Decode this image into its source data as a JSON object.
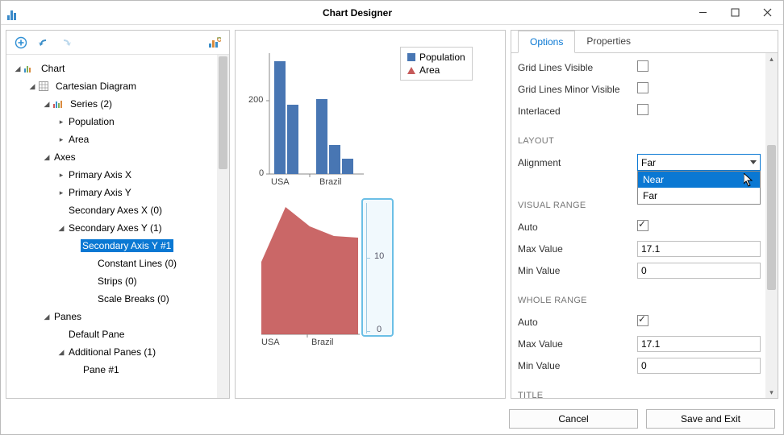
{
  "window": {
    "title": "Chart Designer"
  },
  "tree": {
    "root": "Chart",
    "diagram": "Cartesian Diagram",
    "series_group": "Series (2)",
    "series_pop": "Population",
    "series_area": "Area",
    "axes": "Axes",
    "pax": "Primary Axis X",
    "pay": "Primary Axis Y",
    "sax": "Secondary Axes X (0)",
    "say": "Secondary Axes Y (1)",
    "say1": "Secondary Axis Y #1",
    "constlines": "Constant Lines (0)",
    "strips": "Strips (0)",
    "scalebreaks": "Scale Breaks (0)",
    "panes": "Panes",
    "defpane": "Default Pane",
    "addpanes": "Additional Panes (1)",
    "pane1": "Pane #1"
  },
  "legend": {
    "pop": "Population",
    "area": "Area"
  },
  "props": {
    "tabs": {
      "options": "Options",
      "properties": "Properties"
    },
    "gridlines": "Grid Lines Visible",
    "gridlines_minor": "Grid Lines Minor Visible",
    "interlaced": "Interlaced",
    "sec_layout": "LAYOUT",
    "alignment": "Alignment",
    "alignment_value": "Far",
    "alignment_opts": {
      "near": "Near",
      "far": "Far"
    },
    "sec_visual": "VISUAL RANGE",
    "auto": "Auto",
    "maxval": "Max Value",
    "minval": "Min Value",
    "vr_max": "17.1",
    "vr_min": "0",
    "sec_whole": "WHOLE RANGE",
    "wr_max": "17.1",
    "wr_min": "0",
    "sec_title": "TITLE"
  },
  "footer": {
    "cancel": "Cancel",
    "save": "Save and Exit"
  },
  "chart_data": [
    {
      "type": "bar",
      "categories": [
        "USA",
        "Brazil"
      ],
      "series": [
        {
          "name": "Population",
          "values": [
            [
              310,
              190
            ],
            [
              205,
              80,
              42
            ]
          ]
        }
      ],
      "title": "",
      "xlabel": "",
      "ylabel": "",
      "y_ticks": [
        0,
        200
      ],
      "ylim": [
        0,
        330
      ],
      "pane": "Default Pane",
      "legend": [
        "Population",
        "Area"
      ]
    },
    {
      "type": "area",
      "categories": [
        "USA",
        "Brazil"
      ],
      "series": [
        {
          "name": "Area",
          "values": [
            9.8,
            17.1,
            14.5,
            13.2,
            13.0
          ]
        }
      ],
      "secondary_axis_y": {
        "label": "",
        "ticks": [
          0,
          10
        ],
        "range": [
          0,
          17.1
        ],
        "alignment": "Far"
      },
      "pane": "Pane #1"
    }
  ],
  "axis_ticks": {
    "bar_0": "0",
    "bar_200": "200",
    "area_0": "0",
    "area_10": "10",
    "cat_usa": "USA",
    "cat_brazil": "Brazil"
  }
}
